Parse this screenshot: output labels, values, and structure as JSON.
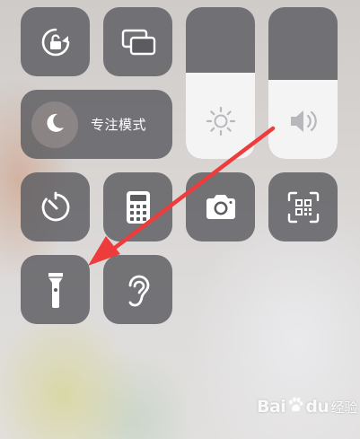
{
  "control_center": {
    "tiles": [
      {
        "id": "orientation-lock",
        "icon": "orientation-lock-icon"
      },
      {
        "id": "screen-mirroring",
        "icon": "screen-mirroring-icon"
      },
      {
        "id": "timer",
        "icon": "timer-icon"
      },
      {
        "id": "calculator",
        "icon": "calculator-icon"
      },
      {
        "id": "camera",
        "icon": "camera-icon"
      },
      {
        "id": "code-scanner",
        "icon": "qr-scan-icon"
      },
      {
        "id": "flashlight",
        "icon": "flashlight-icon"
      },
      {
        "id": "hearing",
        "icon": "ear-icon"
      }
    ],
    "focus": {
      "label": "专注模式",
      "icon": "moon-icon"
    },
    "brightness": {
      "icon": "sun-icon",
      "level": 0.57
    },
    "volume": {
      "icon": "speaker-icon",
      "level": 0.52
    }
  },
  "annotation": {
    "type": "arrow",
    "color": "#ee3b3b",
    "points_to": "flashlight"
  },
  "watermark": {
    "brand": "Bai",
    "brand_suffix": "du",
    "suffix": "经验"
  },
  "colors": {
    "tile_bg": "#5c5c60",
    "slider_fill": "#f4f4f4",
    "icon": "#ffffff",
    "slider_icon": "#8e8e93"
  }
}
